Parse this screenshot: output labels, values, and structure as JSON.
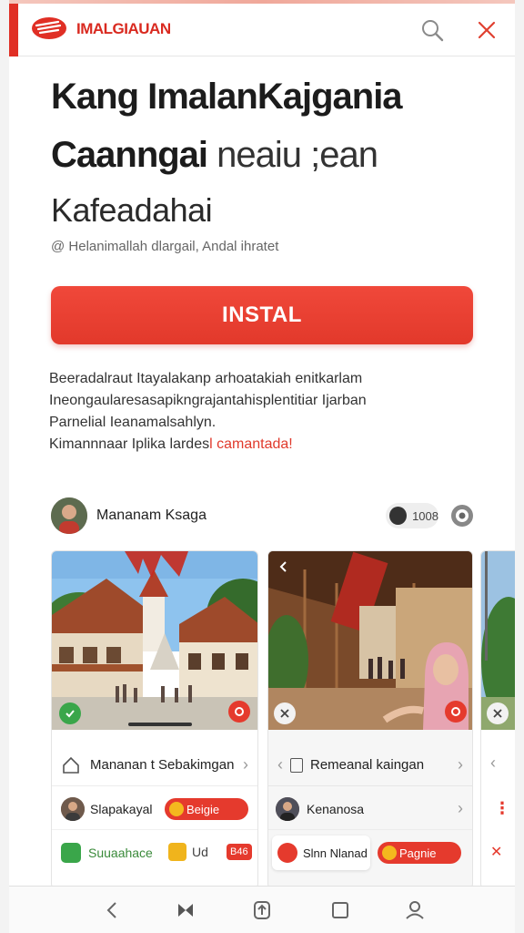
{
  "header": {
    "brand_name": "IMALGIAUAN"
  },
  "hero": {
    "title": "Kang ImalanKajgania",
    "line2_bold": "Caanngai",
    "line2_light": "neaiu ;ean",
    "line3": "Kafeadahai",
    "meta": "@ Helanimallah dlargail, Andal ihratet",
    "install_label": "INSTAL"
  },
  "description": {
    "lines": [
      "Beeradalraut  Itayalakanp arhoatakiah enitkarlam",
      "Ineongaularesasapikngrajantahisplentitiar  Ijarban",
      "Parnelial Ieanamalsahlyn."
    ],
    "last_plain": "Kimannnaar Iplika lardes",
    "last_accent": "l camantada!"
  },
  "author": {
    "name": "Mananam Ksaga",
    "count": "1008"
  },
  "cards": [
    {
      "nav_label": "Mananan t Sebakimgan",
      "row1_label": "Slapakayal",
      "row1_pill": "Beigie",
      "row2_label": "Suuaahace",
      "row2_mid": "Ud",
      "row2_badge": "B46"
    },
    {
      "nav_label": "Remeanal kaingan",
      "row1_label": "Kenanosa",
      "row2_label": "Slnn Nlanad",
      "row2_pill": "Pagnie"
    }
  ],
  "colors": {
    "brand": "#e02f25",
    "install": "#ea4032",
    "accent_text": "#e03a2c"
  },
  "icons": {
    "search": "search-icon",
    "close": "close-icon",
    "back": "back-icon",
    "media": "media-icon",
    "upload": "upload-icon",
    "square": "square-icon",
    "profile": "profile-icon"
  }
}
